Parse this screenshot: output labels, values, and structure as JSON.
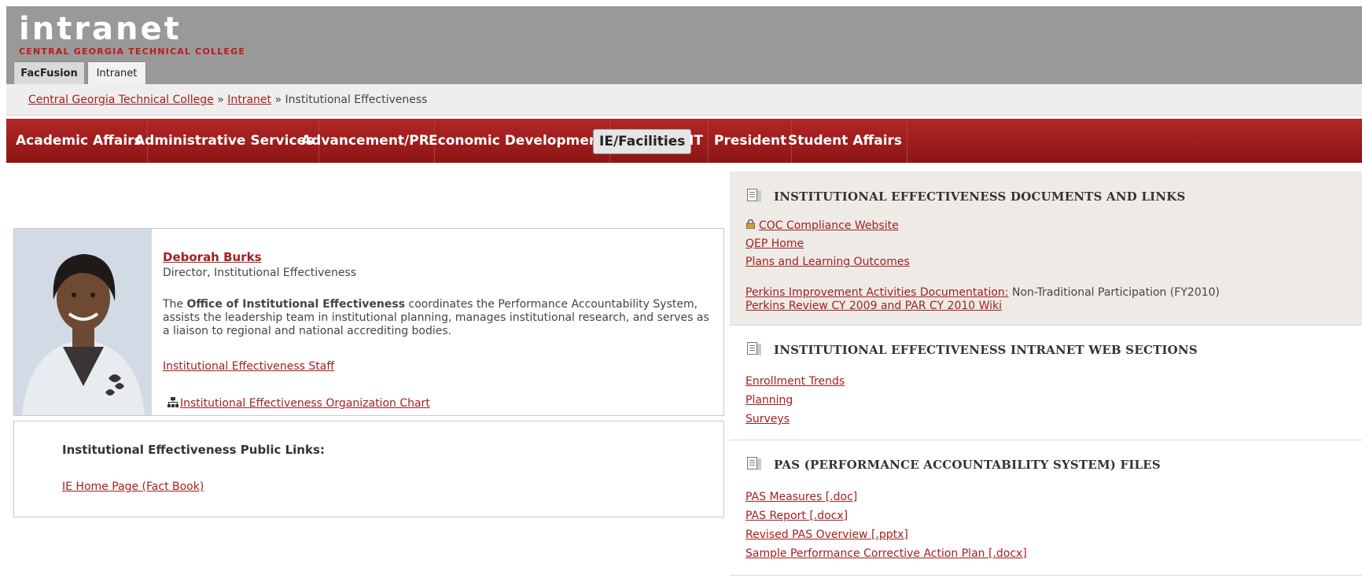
{
  "header": {
    "logo_word": "intranet",
    "logo_subtitle": "CENTRAL GEORGIA TECHNICAL COLLEGE",
    "tabs": [
      {
        "label": "FacFusion",
        "active": false
      },
      {
        "label": "Intranet",
        "active": true
      }
    ],
    "colors": {
      "header_bg": "#999999",
      "brand_red": "#a31f1f"
    }
  },
  "breadcrumb": {
    "items": [
      "Central Georgia Technical College",
      "Intranet"
    ],
    "separator": "»",
    "current": "Institutional Effectiveness"
  },
  "nav": {
    "items": [
      "Academic Affairs",
      "Administrative Services",
      "Advancement/PR",
      "Economic Development",
      "IE/Facilities",
      "IT",
      "President",
      "Student Affairs"
    ],
    "active": "IE/Facilities"
  },
  "profile": {
    "name": "Deborah Burks",
    "role": "Director, Institutional Effectiveness",
    "desc_lead": "The ",
    "desc_bold": "Office of Institutional Effectiveness",
    "desc_rest": " coordinates the Performance Accountability System, assists the leadership team in institutional planning, manages institutional research, and serves as a liaison to regional and national accrediting bodies.",
    "staff_link": "Institutional Effectiveness Staff",
    "org_chart_link": "Institutional Effectiveness Organization Chart",
    "org_icon": "org-chart-icon"
  },
  "public_links": {
    "title": "Institutional Effectiveness Public Links:",
    "link": "IE Home Page (Fact Book)"
  },
  "docs_links": {
    "title": "INSTITUTIONAL EFFECTIVENESS DOCUMENTS AND LINKS",
    "links": [
      "COC Compliance Website",
      "QEP Home",
      "Plans and Learning Outcomes"
    ],
    "perkins_link": "Perkins Improvement Activities Documentation:",
    "perkins_note": " Non-Traditional Participation (FY2010)",
    "perkins_review": "Perkins Review CY 2009 and PAR CY 2010 Wiki",
    "lock_icon": "lock-icon"
  },
  "web_sections": {
    "title": "INSTITUTIONAL EFFECTIVENESS INTRANET WEB SECTIONS",
    "links": [
      "Enrollment Trends",
      "Planning",
      "Surveys"
    ]
  },
  "pas_files": {
    "title": "PAS (PERFORMANCE ACCOUNTABILITY SYSTEM) FILES",
    "links": [
      "PAS Measures [.doc]",
      "PAS Report [.docx]",
      "Revised PAS Overview [.pptx]",
      "Sample Performance Corrective Action Plan [.docx]"
    ]
  }
}
